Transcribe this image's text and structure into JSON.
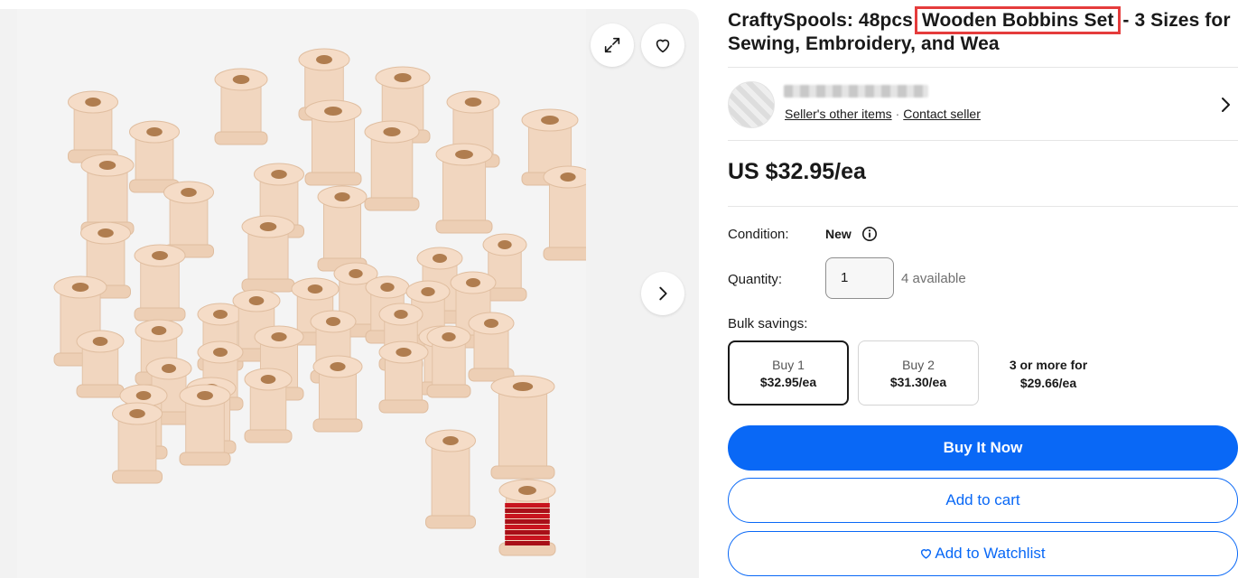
{
  "gallery": {
    "expand_icon": "expand-icon",
    "watch_icon": "heart-icon",
    "next_icon": "chevron-right-icon"
  },
  "listing": {
    "title_part1": "CraftySpools: 48pcs",
    "title_highlight": "Wooden Bobbins Set",
    "title_part2": "- 3 Sizes for Sewing, Embroidery, and Wea",
    "price": "US $32.95/ea"
  },
  "seller": {
    "other_items": "Seller's other items",
    "separator": "·",
    "contact": "Contact seller"
  },
  "details": {
    "condition_label": "Condition:",
    "condition_value": "New",
    "quantity_label": "Quantity:",
    "quantity_value": "1",
    "available": "4 available",
    "bulk_label": "Bulk savings:"
  },
  "bulk": [
    {
      "label": "Buy 1",
      "price": "$32.95/ea"
    },
    {
      "label": "Buy 2",
      "price": "$31.30/ea"
    },
    {
      "label": "3 or more for",
      "price": "$29.66/ea"
    }
  ],
  "actions": {
    "buy_now": "Buy It Now",
    "add_to_cart": "Add to cart",
    "add_to_watchlist": "Add to Watchlist"
  },
  "colors": {
    "primary": "#0968f6",
    "highlight_box": "#e53c3c",
    "spool_wood": "#f1d6bf",
    "wire": "#c8141e"
  }
}
